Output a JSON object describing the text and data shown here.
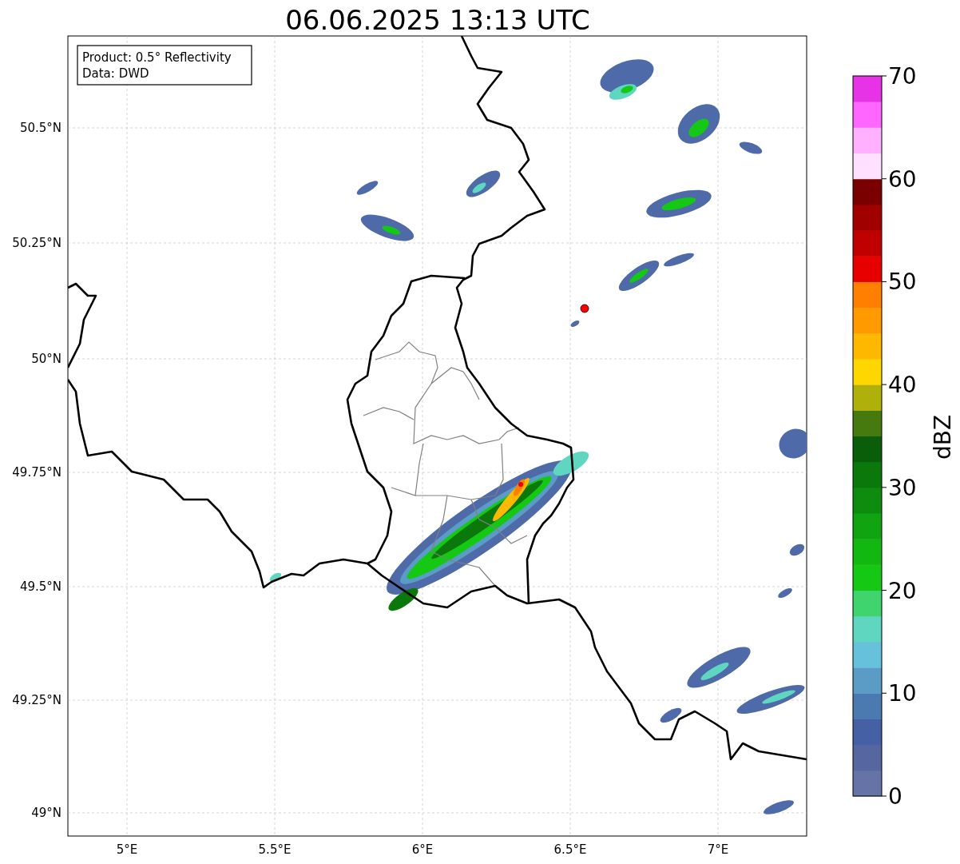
{
  "title": "06.06.2025 13:13 UTC",
  "legend": {
    "lines": [
      "Product: 0.5° Reflectivity",
      "Data: DWD"
    ]
  },
  "map": {
    "lat_labels": [
      "50.5°N",
      "50.25°N",
      "50°N",
      "49.75°N",
      "49.5°N",
      "49.25°N",
      "49°N"
    ],
    "lon_labels": [
      "5°E",
      "5.5°E",
      "6°E",
      "6.5°E",
      "7°E"
    ]
  },
  "colorbar": {
    "label": "dBZ",
    "tick_labels": [
      "70",
      "60",
      "50",
      "40",
      "30",
      "20",
      "10",
      "0"
    ],
    "bins": [
      {
        "color": "#6673a6"
      },
      {
        "color": "#5566a0"
      },
      {
        "color": "#4560a4"
      },
      {
        "color": "#4a7ab0"
      },
      {
        "color": "#5a9cc6"
      },
      {
        "color": "#66c2dc"
      },
      {
        "color": "#5ed6c0"
      },
      {
        "color": "#3fd46e"
      },
      {
        "color": "#14c814"
      },
      {
        "color": "#10b810"
      },
      {
        "color": "#10a510"
      },
      {
        "color": "#0e8c0e"
      },
      {
        "color": "#0b780b"
      },
      {
        "color": "#0a5e0a"
      },
      {
        "color": "#467a0e"
      },
      {
        "color": "#b0b00a"
      },
      {
        "color": "#ffd700"
      },
      {
        "color": "#ffb800"
      },
      {
        "color": "#ff9a00"
      },
      {
        "color": "#ff7f00"
      },
      {
        "color": "#e60000"
      },
      {
        "color": "#c00000"
      },
      {
        "color": "#a00000"
      },
      {
        "color": "#7a0000"
      },
      {
        "color": "#ffe0ff"
      },
      {
        "color": "#ffb0ff"
      },
      {
        "color": "#ff66ff"
      },
      {
        "color": "#e633e6"
      }
    ]
  }
}
